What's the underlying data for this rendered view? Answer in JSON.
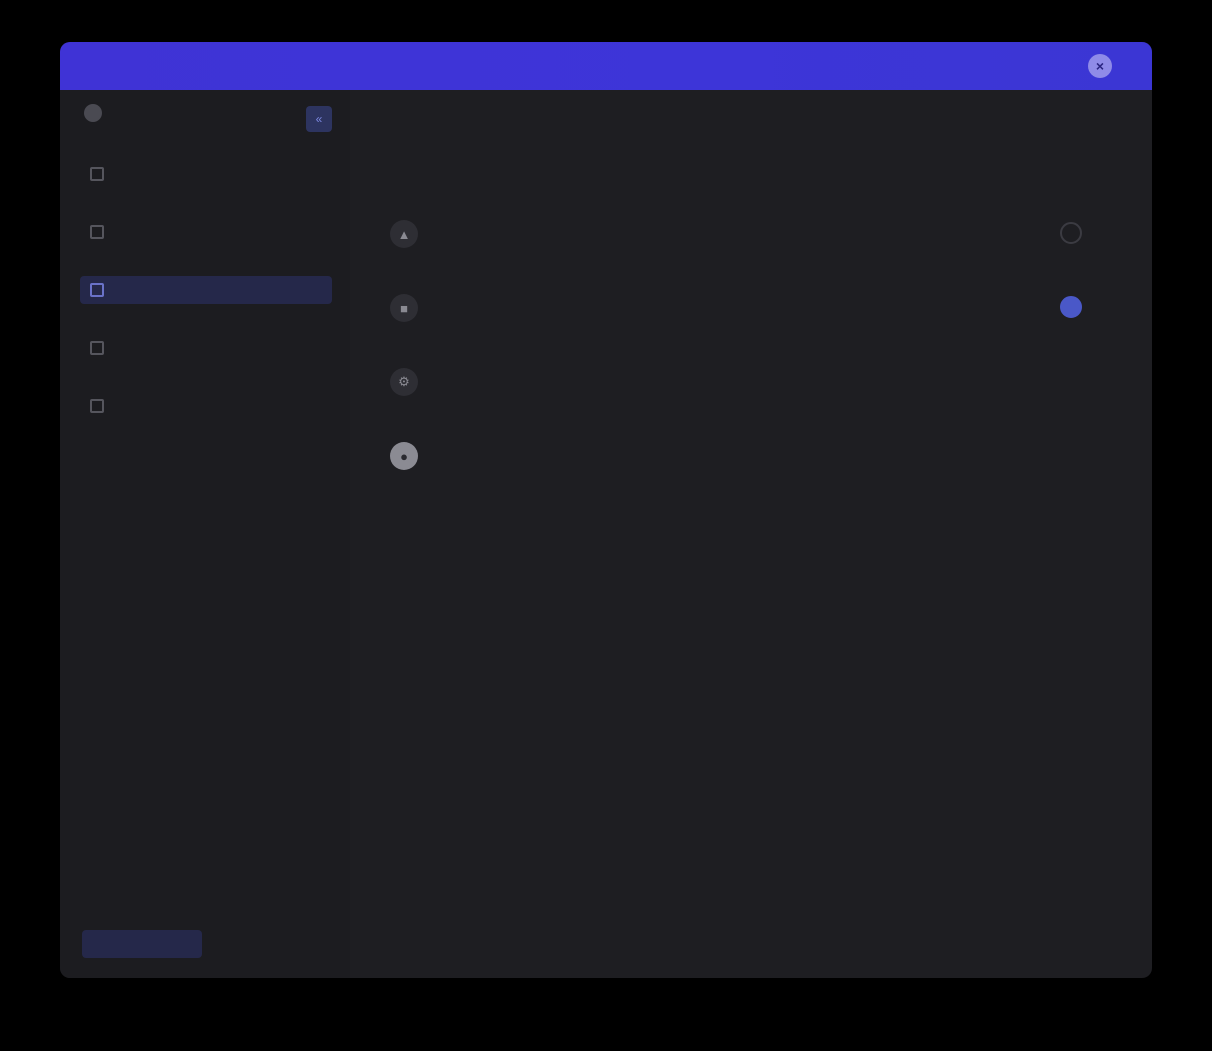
{
  "window": {
    "title": "",
    "close_label": "×"
  },
  "sidebar": {
    "brand": "",
    "collapse_label": "«",
    "items": [
      {
        "label": ""
      },
      {
        "label": ""
      },
      {
        "label": "",
        "active": true
      },
      {
        "label": ""
      },
      {
        "label": ""
      }
    ],
    "footer_button": "",
    "footer_text": ""
  },
  "tabs": [
    {
      "label": ""
    },
    {
      "label": ""
    }
  ],
  "main": {
    "heading": "",
    "subheading": "",
    "section_title": "",
    "options": [
      {
        "title": "",
        "desc": "",
        "icon": "shield-icon",
        "selected": false
      },
      {
        "title": "",
        "desc": "",
        "icon": "lock-icon",
        "selected": true
      },
      {
        "title": "",
        "desc": "",
        "icon": "gear-icon",
        "selected": false
      },
      {
        "title": "",
        "desc": "",
        "icon": "avatar-icon",
        "selected": false
      }
    ]
  },
  "colors": {
    "titlebar": "#3f33d6",
    "accent": "#4a58c8",
    "window_bg": "#1e1e22"
  }
}
